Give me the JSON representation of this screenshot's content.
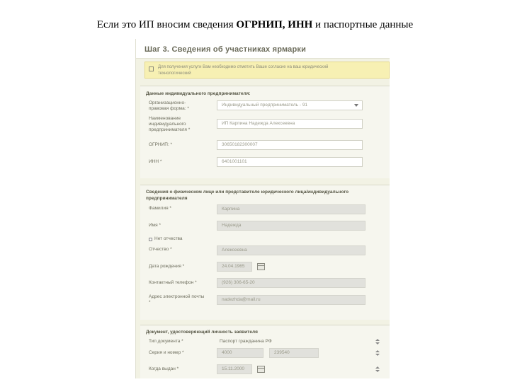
{
  "caption": {
    "before": "Если это ИП вносим сведения ",
    "bold": "ОГРНИП, ИНН",
    "after": " и паспортные данные"
  },
  "header": {
    "title": "Шаг 3. Сведения об участниках ярмарки"
  },
  "notice": {
    "text": "Для получения услуги Вам необходимо отметить Ваше согласие на ваш юридический технологический"
  },
  "section1": {
    "title": "Данные индивидуального предпринимателя:",
    "legal_form": {
      "label": "Организационно-правовая форма: *",
      "value": "Индивидуальный предприниматель - 91"
    },
    "name": {
      "label": "Наименование индивидуального предпринимателя *",
      "value": "ИП Карпина Надежда Алексеевна"
    },
    "ogrnip": {
      "label": "ОГРНИП: *",
      "value": "30650182300007"
    },
    "inn": {
      "label": "ИНН *",
      "value": "6401001101"
    }
  },
  "section2": {
    "title": "Сведения о физическом лице или представителе юридического лица/индивидуального предпринимателя",
    "surname": {
      "label": "Фамилия *",
      "value": "Карпина"
    },
    "first_name": {
      "label": "Имя *",
      "value": "Надежда"
    },
    "no_patronymic": {
      "label": "Нет отчества"
    },
    "patronymic": {
      "label": "Отчество *",
      "value": "Алексеевна"
    },
    "birth_date": {
      "label": "Дата рождения *",
      "value": "24.04.1965"
    },
    "phone": {
      "label": "Контактный телефон *",
      "value": "(926) 306-65-20"
    },
    "email": {
      "label": "Адрес электронной почты *",
      "value": "nadezhda@mail.ru"
    }
  },
  "section3": {
    "title": "Документ, удостоверяющий личность заявителя",
    "doc_type": {
      "label": "Тип документа *",
      "value": "Паспорт гражданина РФ"
    },
    "series_number": {
      "label": "Серия и номер *",
      "series": "4000",
      "number": "239540"
    },
    "issue_date": {
      "label": "Когда выдан *",
      "value": "15.11.2000"
    }
  },
  "colors": {
    "panel_bg": "#f2f2e4",
    "notice_bg": "#f7f0b3",
    "field_ro": "#e1e1dc"
  }
}
